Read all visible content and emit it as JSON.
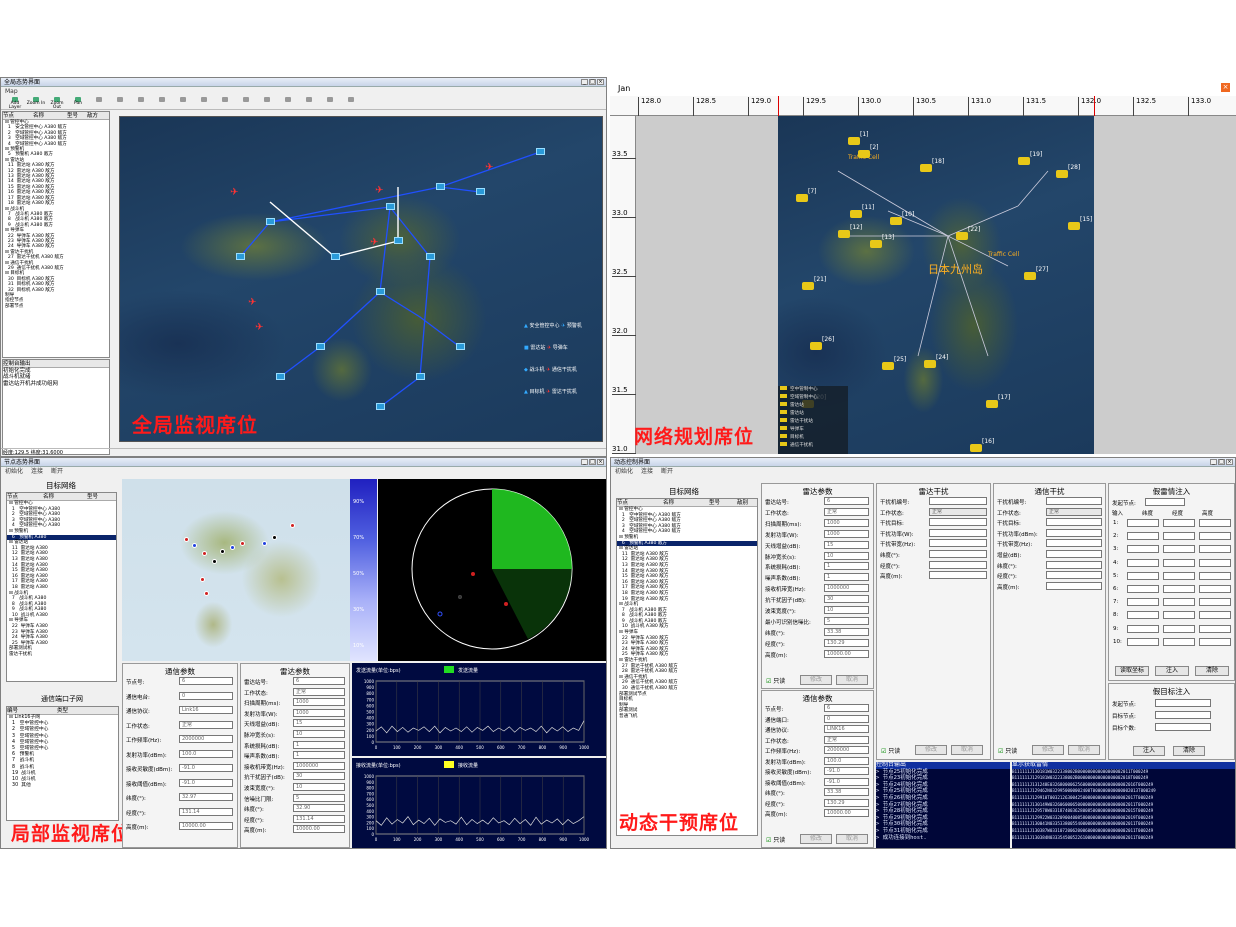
{
  "q1": {
    "title": "全局态势界面",
    "menu": "Map",
    "toolbar": [
      "Add Layer",
      "Zoom In",
      "Zoom Out",
      "Pan",
      "",
      "",
      "",
      "",
      "",
      "",
      "",
      "",
      "",
      "",
      "",
      "",
      ""
    ],
    "treeHeader": [
      "节点",
      "名称",
      "型号",
      "敌方"
    ],
    "treeRows": [
      "⊟ 管控中心",
      "  1   安全管控中心 A380 敌方",
      "  2   空域管控中心 A380 敌方",
      "  3   空域管控中心 A380 敌方",
      "  4   空域管控中心 A380 敌方",
      "⊟ 预警机",
      "  5   预警机 A380 敌方",
      "⊟ 雷达站",
      "  11  雷达站 A380 敌方",
      "  12  雷达站 A380 敌方",
      "  13  雷达站 A380 敌方",
      "  14  雷达站 A380 敌方",
      "  15  雷达站 A380 敌方",
      "  16  雷达站 A380 敌方",
      "  17  雷达站 A380 敌方",
      "  18  雷达站 A380 敌方",
      "⊟ 战斗机",
      "  7   战斗机 A380 敌方",
      "  8   战斗机 A380 敌方",
      "  9   战斗机 A380 敌方",
      "⊟ 导弹车",
      "  22  导弹车 A380 敌方",
      "  23  导弹车 A380 敌方",
      "  24  导弹车 A380 敌方",
      "⊟ 雷达干扰机",
      "  27  雷达干扰机 A380 敌方",
      "⊟ 通信干扰机",
      "  29  通信干扰机 A380 敌方",
      "⊟ 目标机",
      "  30  目标机 A380 敌方",
      "  31  目标机 A380 敌方",
      "  32  目标机 A380 敌方",
      "制导",
      "指控节点",
      "部署节点"
    ],
    "consoleTitle": "控制台输出",
    "console": [
      "初始化完成",
      "战斗机就绪",
      "雷达站开机并成功组网"
    ],
    "status": "经度:129.5 纬度:31.6000",
    "legend": [
      "安全管控中心",
      "预警机",
      "雷达站",
      "导弹车",
      "战斗机",
      "通信干扰机",
      "目标机",
      "雷达干扰机"
    ],
    "label": "全局监视席位"
  },
  "q2": {
    "title": "Jan",
    "ticks": [
      "128.0",
      "128.5",
      "129.0",
      "129.5",
      "130.0",
      "130.5",
      "131.0",
      "131.5",
      "132.0",
      "132.5",
      "133.0"
    ],
    "vticks": [
      "33.5",
      "33.0",
      "32.5",
      "32.0",
      "31.5",
      "31.0"
    ],
    "legend": [
      "空中管制中心",
      "空域管制中心",
      "雷达站",
      "雷达站",
      "雷达干扰站",
      "导弹车",
      "目标机",
      "通信干扰机"
    ],
    "mapText": [
      "日本九州岛",
      "Traffic Cell",
      "Traffic Cell"
    ],
    "nodes": [
      "[1]",
      "[2]",
      "[7]",
      "[10]",
      "[11]",
      "[12]",
      "[13]",
      "[15]",
      "[16]",
      "[17]",
      "[18]",
      "[19]",
      "[20]",
      "[21]",
      "[22]",
      "[24]",
      "[25]",
      "[26]",
      "[27]",
      "[28]"
    ],
    "label": "网络规划席位"
  },
  "q3": {
    "title": "节点态势界面",
    "menu": [
      "初始化",
      "连接",
      "断开"
    ],
    "netTitle": "目标网络",
    "treeHeader": [
      "节点",
      "名称",
      "型号"
    ],
    "treeRows": [
      "⊟ 管控中心",
      "  1   空中管控中心 A380",
      "  2   空域管控中心 A380",
      "  3   空域管控中心 A380",
      "  4   空域管控中心 A380",
      "⊟ 预警机",
      "  6   预警机 A380",
      "⊟ 雷达站",
      "  11  雷达站 A380",
      "  12  雷达站 A380",
      "  13  雷达站 A380",
      "  14  雷达站 A380",
      "  15  雷达站 A380",
      "  16  雷达站 A380",
      "  17  雷达站 A380",
      "  18  雷达站 A380",
      "⊟ 战斗机",
      "  7   战斗机 A380",
      "  8   战斗机 A380",
      "  9   战斗机 A380",
      "  10  战斗机 A380",
      "⊟ 导弹车",
      "  22  导弹车 A380",
      "  23  导弹车 A380",
      "  24  导弹车 A380",
      "  25  导弹车 A380",
      "部署测试机",
      "雷达干扰机"
    ],
    "portTitle": "通信端口子网",
    "portHeader": [
      "编号",
      "类型"
    ],
    "portRows": [
      "⊟ Link16子网",
      "  1   空中管控中心",
      "  2   空域管控中心",
      "  3   空域管控中心",
      "  4   空域管控中心",
      "  5   空域管控中心",
      "  6   预警机",
      "  7   战斗机",
      "  8   战斗机",
      "  19  战斗机",
      "  10  战斗机",
      "  30  其他"
    ],
    "commTitle": "通信参数",
    "comm": [
      [
        "节点号:",
        "6"
      ],
      [
        "通信电台:",
        "0"
      ],
      [
        "通信协议:",
        "Link16"
      ],
      [
        "工作状态:",
        "正常"
      ],
      [
        "工作频率(Hz):",
        "2000000"
      ],
      [
        "发射功率(dBm):",
        "100.0"
      ],
      [
        "接收灵敏度(dBm):",
        "-91.0"
      ],
      [
        "接收阈值(dBm):",
        "-91.0"
      ],
      [
        "纬度(°):",
        "32.97"
      ],
      [
        "经度(°):",
        "131.14"
      ],
      [
        "高度(m):",
        "10000.00"
      ]
    ],
    "radarTitle": "雷达参数",
    "radar": [
      [
        "雷达站号:",
        "6"
      ],
      [
        "工作状态:",
        "正常"
      ],
      [
        "扫描周期(ms):",
        "1000"
      ],
      [
        "发射功率(W):",
        "1000"
      ],
      [
        "天线增益(dB):",
        "15"
      ],
      [
        "脉冲宽长(s):",
        "10"
      ],
      [
        "系统损耗(dB):",
        "1"
      ],
      [
        "噪声系数(dB):",
        "1"
      ],
      [
        "接收机带宽(Hz):",
        "1000000"
      ],
      [
        "抗干扰因子(dB):",
        "30"
      ],
      [
        "波束宽度(°):",
        "10"
      ],
      [
        "信噪比门限:",
        "5"
      ],
      [
        "纬度(°):",
        "32.90"
      ],
      [
        "经度(°):",
        "131.14"
      ],
      [
        "高度(m):",
        "10000.00"
      ]
    ],
    "chart1": {
      "title": "发送流量(单位:bps)",
      "legend": "发送流量",
      "yt": [
        "1000",
        "900",
        "800",
        "700",
        "600",
        "500",
        "400",
        "300",
        "200",
        "100",
        "0"
      ],
      "xt": [
        "0",
        "100",
        "200",
        "300",
        "400",
        "500",
        "600",
        "700",
        "800",
        "900",
        "1000"
      ],
      "series": [
        180,
        250,
        150,
        260,
        170,
        240,
        160,
        230,
        190,
        250,
        170,
        260,
        150,
        240,
        180,
        230,
        170,
        250,
        160,
        240,
        190,
        260,
        170,
        230,
        180,
        250,
        160,
        240,
        190,
        230,
        170,
        260,
        150,
        240,
        180,
        250,
        170,
        230,
        190,
        350
      ]
    },
    "chart2": {
      "title": "接收流量(单位:bps)",
      "legend": "接收流量",
      "yt": [
        "1000",
        "900",
        "800",
        "700",
        "600",
        "500",
        "400",
        "300",
        "200",
        "100",
        "0"
      ],
      "xt": [
        "0",
        "100",
        "200",
        "300",
        "400",
        "500",
        "600",
        "700",
        "800",
        "900",
        "1000"
      ],
      "series": [
        230,
        150,
        280,
        170,
        250,
        190,
        300,
        160,
        240,
        180,
        270,
        150,
        260,
        200,
        230,
        170,
        290,
        160,
        250,
        180,
        240,
        170,
        280,
        190,
        230,
        160,
        270,
        180,
        250,
        150,
        290,
        170,
        240,
        190,
        260,
        160,
        250,
        180,
        230,
        300
      ]
    },
    "scaleLabels": [
      "90%",
      "70%",
      "50%",
      "30%",
      "10%"
    ],
    "label": "局部监视席位"
  },
  "q4": {
    "title": "动态控制界面",
    "menu": [
      "初始化",
      "连接",
      "断开"
    ],
    "netTitle": "目标网络",
    "treeHeader": [
      "节点",
      "名称",
      "型号",
      "敌别"
    ],
    "treeRows": [
      "⊟ 管控中心",
      "  1   空中管控中心 A380 敌方",
      "  2   空域管控中心 A380 敌方",
      "  3   空域管控中心 A380 敌方",
      "  4   空域管控中心 A380 敌方",
      "⊟ 预警机",
      "  6   预警机 A380 敌方",
      "⊟ 雷达站",
      "  11  雷达站 A380 敌方",
      "  12  雷达站 A380 敌方",
      "  13  雷达站 A380 敌方",
      "  14  雷达站 A380 敌方",
      "  15  雷达站 A380 敌方",
      "  16  雷达站 A380 敌方",
      "  17  雷达站 A380 敌方",
      "  18  雷达站 A380 敌方",
      "  19  雷达站 A380 敌方",
      "⊟ 战斗机",
      "  7   战斗机 A380 敌方",
      "  8   战斗机 A380 敌方",
      "  9   战斗机 A380 敌方",
      "  10  战斗机 A380 敌方",
      "⊟ 导弹车",
      "  22  导弹车 A380 敌方",
      "  23  导弹车 A380 敌方",
      "  24  导弹车 A380 敌方",
      "  25  导弹车 A380 敌方",
      "⊟ 雷达干扰机",
      "  27  雷达干扰机 A380 敌方",
      "  28  雷达干扰机 A380 敌方",
      "⊟ 通信干扰机",
      "  29  通信干扰机 A380 敌方",
      "  30  通信干扰机 A380 敌方",
      "部署测试节点",
      "目标机",
      "制导",
      "部署测试",
      "普通飞机"
    ],
    "radarTitle": "雷达参数",
    "radar": [
      [
        "雷达站号:",
        "6"
      ],
      [
        "工作状态:",
        "正常"
      ],
      [
        "扫描周期(ms):",
        "1000"
      ],
      [
        "发射功率(W):",
        "1000"
      ],
      [
        "天线增益(dB):",
        "15"
      ],
      [
        "脉冲宽长(s):",
        "10"
      ],
      [
        "系统损耗(dB):",
        "1"
      ],
      [
        "噪声系数(dB):",
        "1"
      ],
      [
        "接收机带宽(Hz):",
        "1000000"
      ],
      [
        "抗干扰因子(dB):",
        "30"
      ],
      [
        "波束宽度(°):",
        "10"
      ],
      [
        "最小可识别信噪比:",
        "5"
      ],
      [
        "纬度(°):",
        "33.38"
      ],
      [
        "经度(°):",
        "130.29"
      ],
      [
        "高度(m):",
        "10000.00"
      ]
    ],
    "commTitle": "通信参数",
    "comm": [
      [
        "节点号:",
        "6"
      ],
      [
        "通信端口:",
        "0"
      ],
      [
        "通信协议:",
        "LINK16"
      ],
      [
        "工作状态:",
        "正常"
      ],
      [
        "工作频率(Hz):",
        "2000000"
      ],
      [
        "发射功率(dBm):",
        "100.0"
      ],
      [
        "接收灵敏度(dBm):",
        "-91.0"
      ],
      [
        "接收阈值(dBm):",
        "-91.0"
      ],
      [
        "纬度(°):",
        "33.38"
      ],
      [
        "经度(°):",
        "130.29"
      ],
      [
        "高度(m):",
        "10000.00"
      ]
    ],
    "rjTitle": "雷达干扰",
    "rj": [
      "干扰机编号:",
      "工作状态:",
      "干扰目标:",
      "干扰功率(W):",
      "干扰带宽(Hz):",
      "纬度(°):",
      "经度(°):",
      "高度(m):"
    ],
    "rjStatus": "正常",
    "cjTitle": "通信干扰",
    "cj": [
      "干扰机编号:",
      "工作状态:",
      "干扰目标:",
      "干扰功率(dBm):",
      "干扰带宽(Hz):",
      "增益(dB):",
      "纬度(°):",
      "经度(°):",
      "高度(m):"
    ],
    "cjStatus": "正常",
    "fakeTitle": "假雷情注入",
    "fakeStart": "发起节点:",
    "fakeHdr": [
      "输入",
      "纬度",
      "经度",
      "高度"
    ],
    "fakeRows": [
      "1:",
      "2:",
      "3:",
      "4:",
      "5:",
      "6:",
      "7:",
      "8:",
      "9:",
      "10:"
    ],
    "fakeBtns": [
      "读取坐标",
      "注入",
      "清除"
    ],
    "fakeTgtTitle": "假目标注入",
    "fakeTgt": [
      "发起节点:",
      "目标节点:",
      "目标个数:"
    ],
    "fakeTgtBtns": [
      "注入",
      "清除"
    ],
    "readonly": "只读",
    "modify": "修改",
    "cancel": "取消",
    "consoleTitle": "控制台输出",
    "console": [
      "> 节点25初始化完成",
      "> 节点23初始化完成",
      "> 节点24初始化完成",
      "> 节点25初始化完成",
      "> 节点26初始化完成",
      "> 节点27初始化完成",
      "> 节点28初始化完成",
      "> 节点29初始化完成",
      "> 节点30初始化完成",
      "> 节点31初始化完成",
      "> 成功连接到host."
    ],
    "alarmTitle": "显示获取雷情",
    "alarm": [
      "B111111J130181W0322338002B000000000000000002011T000249",
      "B111111J129181W0322338002B000000000000000002018T000249",
      "B111111J131248E0326800006256000000000000000002016T000249",
      "B111111J129462N0329950000002400T000000000000002013T000249",
      "B111111J129910T0032126300425000000000000000002017T000249",
      "B111111J130149W0326060006500000000000000000002011T000249",
      "B111111J129578W0331874003628008500000000000002015T000249",
      "B111111J129922W0332090040085800000000000000002019T000249",
      "B111111J130041N0335338005540000000000000000002011T000249",
      "B111111J130387W0331072006200060000000000000002011T000249",
      "B111111J130384N0333545005226100000000000000002011T000249"
    ],
    "label": "动态干预席位"
  }
}
